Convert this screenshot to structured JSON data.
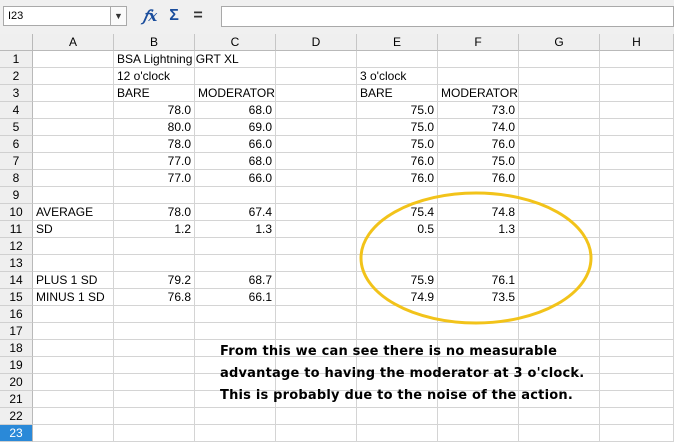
{
  "formula_bar": {
    "cell_ref": "I23",
    "fx": "𝑓x",
    "sigma": "Σ",
    "equals": "=",
    "content": ""
  },
  "columns": [
    "A",
    "B",
    "C",
    "D",
    "E",
    "F",
    "G",
    "H"
  ],
  "rows": [
    "1",
    "2",
    "3",
    "4",
    "5",
    "6",
    "7",
    "8",
    "9",
    "10",
    "11",
    "12",
    "13",
    "14",
    "15",
    "16",
    "17",
    "18",
    "19",
    "20",
    "21",
    "22",
    "23"
  ],
  "active_row": "23",
  "cells": {
    "B1": "BSA Lightning GRT XL",
    "B2": "12 o'clock",
    "E2": "3 o'clock",
    "B3": "BARE",
    "C3": "MODERATOR",
    "E3": "BARE",
    "F3": "MODERATOR",
    "B4": "78.0",
    "C4": "68.0",
    "E4": "75.0",
    "F4": "73.0",
    "B5": "80.0",
    "C5": "69.0",
    "E5": "75.0",
    "F5": "74.0",
    "B6": "78.0",
    "C6": "66.0",
    "E6": "75.0",
    "F6": "76.0",
    "B7": "77.0",
    "C7": "68.0",
    "E7": "76.0",
    "F7": "75.0",
    "B8": "77.0",
    "C8": "66.0",
    "E8": "76.0",
    "F8": "76.0",
    "A10": "AVERAGE",
    "B10": "78.0",
    "C10": "67.4",
    "E10": "75.4",
    "F10": "74.8",
    "A11": "SD",
    "B11": "1.2",
    "C11": "1.3",
    "E11": "0.5",
    "F11": "1.3",
    "A14": "PLUS 1 SD",
    "B14": "79.2",
    "C14": "68.7",
    "E14": "75.9",
    "F14": "76.1",
    "A15": "MINUS 1 SD",
    "B15": "76.8",
    "C15": "66.1",
    "E15": "74.9",
    "F15": "73.5"
  },
  "annotation": {
    "line1": "From this we can see there is no measurable",
    "line2": "advantage to having the moderator at 3 o'clock.",
    "line3": "This is probably due to the noise of the action.",
    "ellipse_color": "#f2c31a"
  }
}
